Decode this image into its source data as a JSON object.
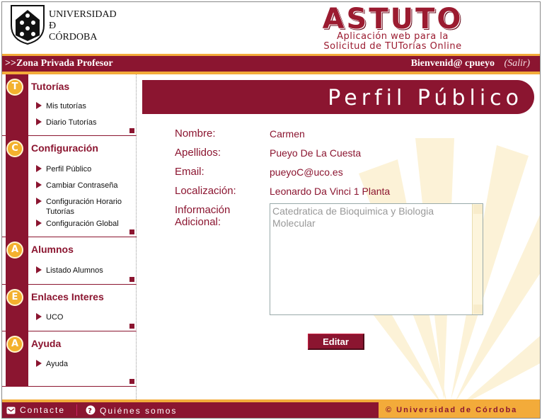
{
  "header": {
    "university_lines": [
      "UNIVERSIDAD",
      "Ð",
      "CÓRDOBA"
    ],
    "app_name": "ASTUTO",
    "app_subtitle_1": "Aplicación web para la",
    "app_subtitle_2": "Solicitud de TUTorías Online"
  },
  "topbar": {
    "zone": ">>Zona Privada Profesor",
    "welcome": "Bienvenid@ cpueyo",
    "logout": "(Salir)"
  },
  "sidebar": {
    "sections": [
      {
        "badge": "T",
        "title": "Tutorías",
        "items": [
          "Mis tutorías",
          "Diario Tutorías"
        ]
      },
      {
        "badge": "C",
        "title": "Configuración",
        "items": [
          "Perfil Público",
          "Cambiar Contraseña",
          "Configuración Horario",
          "Tutorías",
          "Configuración Global"
        ]
      },
      {
        "badge": "A",
        "title": "Alumnos",
        "items": [
          "Listado Alumnos"
        ]
      },
      {
        "badge": "E",
        "title": "Enlaces Interes",
        "items": [
          "UCO"
        ]
      },
      {
        "badge": "A",
        "title": "Ayuda",
        "items": [
          "Ayuda"
        ]
      }
    ]
  },
  "main": {
    "page_title": "Perfil Público",
    "fields": [
      {
        "label": "Nombre:",
        "value": "Carmen"
      },
      {
        "label": "Apellidos:",
        "value": "Pueyo De La Cuesta"
      },
      {
        "label": "Email:",
        "value": "pueyoC@uco.es"
      },
      {
        "label": "Localización:",
        "value": "Leonardo Da Vinci 1 Planta"
      }
    ],
    "info_label_1": "Información",
    "info_label_2": "Adicional:",
    "info_value": "Catedratica de Bioquimica y Biologia Molecular",
    "edit_button": "Editar"
  },
  "footer": {
    "contact": "Contacte",
    "about": "Quiénes somos",
    "copyright": "© Universidad de Córdoba"
  },
  "colors": {
    "primary": "#8b1530",
    "accent": "#f3ab3a"
  }
}
